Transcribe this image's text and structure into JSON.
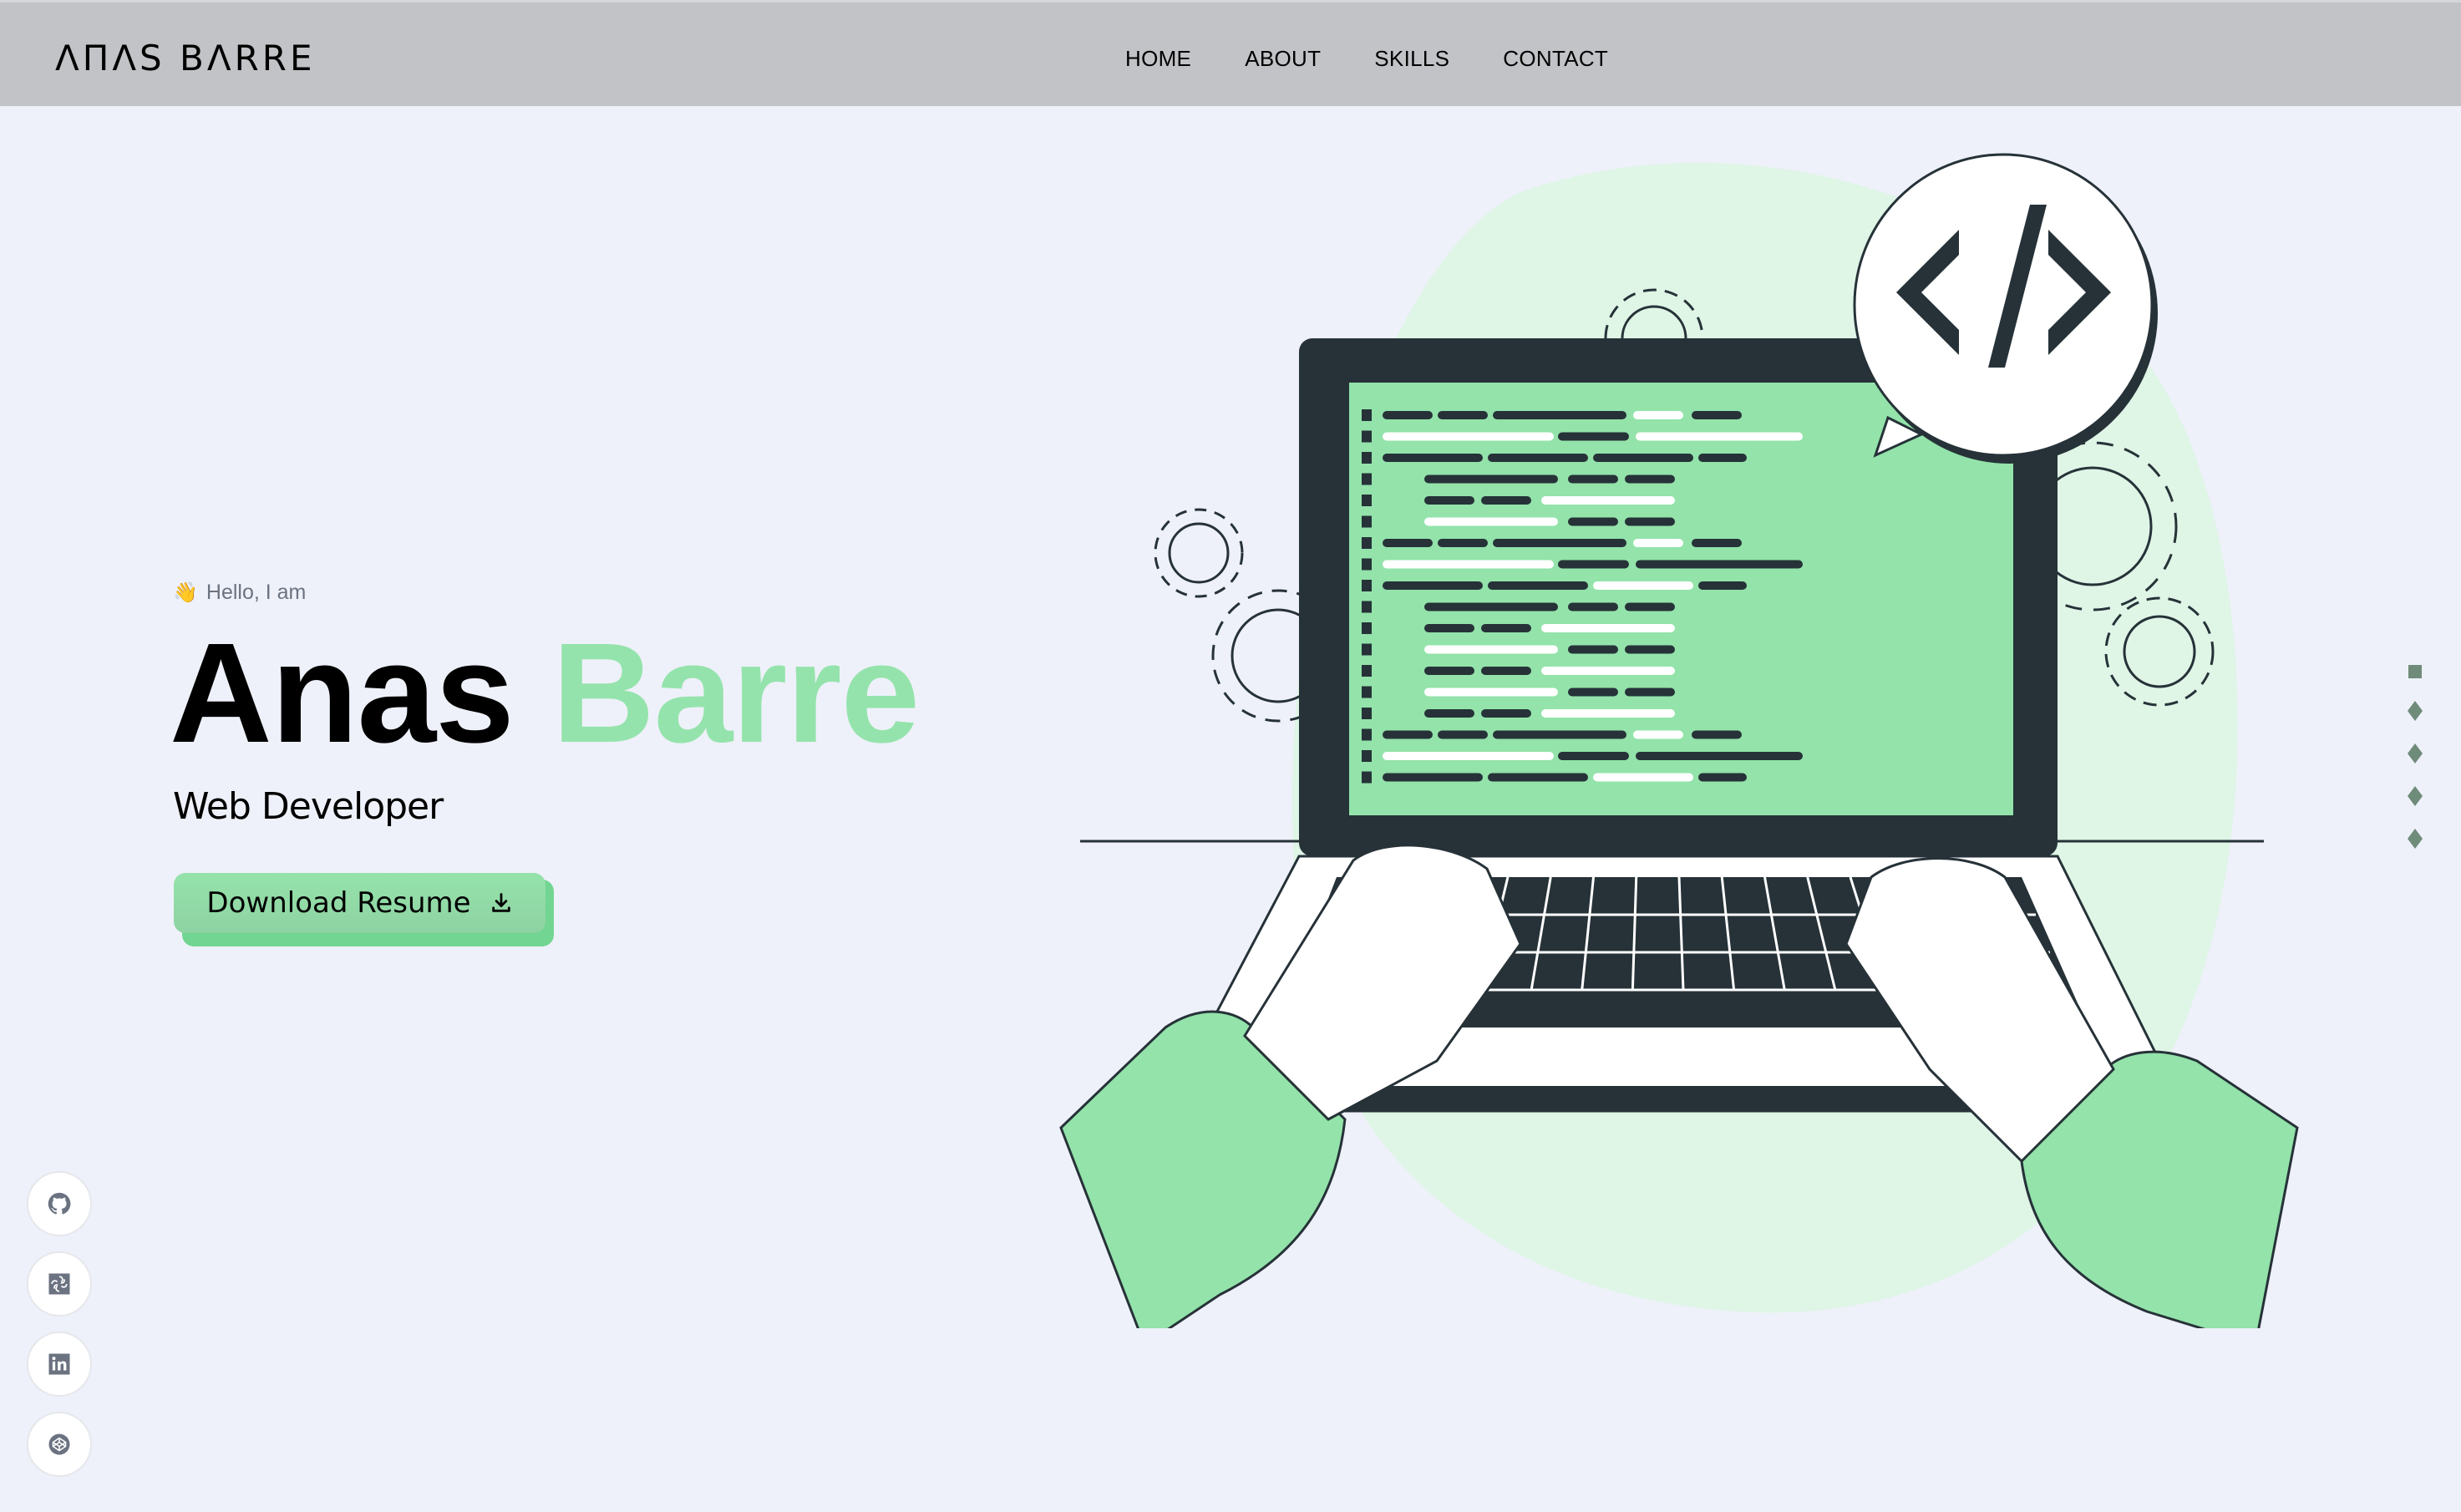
{
  "header": {
    "logo": "ΛΠΛЅ BΛRRE",
    "logo_alt": "Anas Barre",
    "nav": [
      {
        "label": "HOME"
      },
      {
        "label": "ABOUT"
      },
      {
        "label": "SKILLS"
      },
      {
        "label": "CONTACT"
      }
    ]
  },
  "hero": {
    "greeting_icon": "waving-hand-icon",
    "greeting_emoji": "👋",
    "greeting": "Hello, I am",
    "first_name": "Anas",
    "last_name": "Barre",
    "role": "Web Developer",
    "cta_label": "Download Resume",
    "cta_icon": "download-icon"
  },
  "socials": [
    {
      "name": "github",
      "icon": "github-icon"
    },
    {
      "name": "solo-learn",
      "icon": "sololearn-icon"
    },
    {
      "name": "linkedin",
      "icon": "linkedin-icon"
    },
    {
      "name": "codepen",
      "icon": "codepen-icon"
    }
  ],
  "section_nav": {
    "count": 5,
    "active_index": 0
  },
  "illustration": {
    "description": "Hands typing on laptop with code on screen and </> speech bubble",
    "code_symbol": "</>"
  },
  "colors": {
    "accent": "#95e3ac",
    "header_bg": "#c2c3c7",
    "page_bg": "#eef1f9",
    "dark": "#263238",
    "dot": "#6f8c7a"
  }
}
